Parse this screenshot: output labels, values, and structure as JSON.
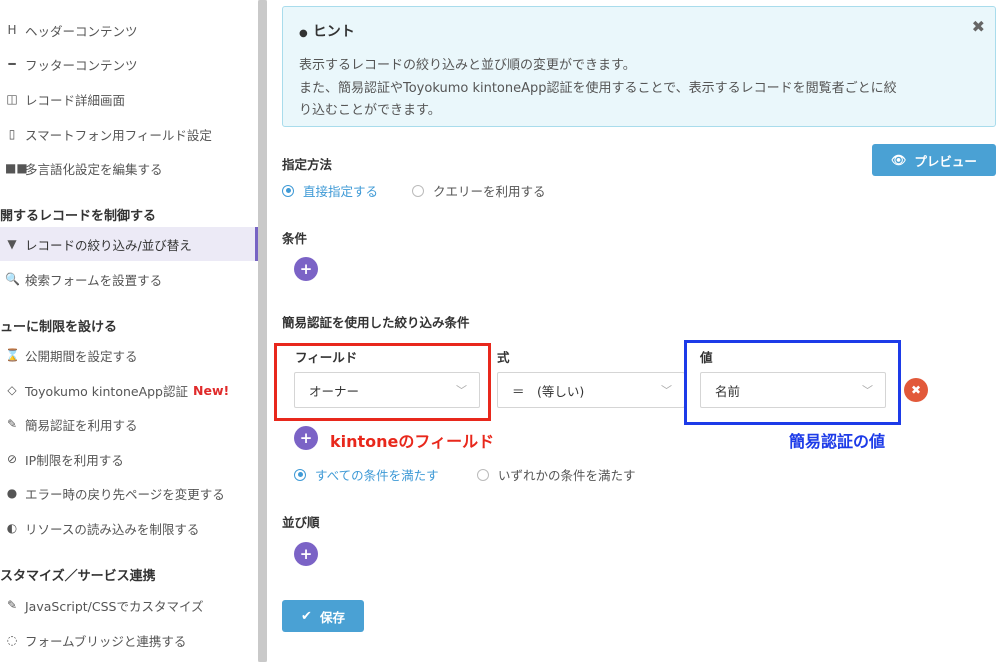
{
  "sidebar": {
    "items_top": [
      {
        "icon": "H",
        "label": "ヘッダーコンテンツ"
      },
      {
        "icon": "━",
        "label": "フッターコンテンツ"
      },
      {
        "icon": "◫",
        "label": "レコード詳細画面"
      },
      {
        "icon": "▯",
        "label": "スマートフォン用フィールド設定"
      },
      {
        "icon": "■■",
        "label": "多言語化設定を編集する"
      }
    ],
    "section1": "開するレコードを制御する",
    "items_record": [
      {
        "icon": "▼",
        "label": "レコードの絞り込み/並び替え"
      },
      {
        "icon": "🔍",
        "label": "検索フォームを設置する"
      }
    ],
    "section2": "ューに制限を設ける",
    "items_limit": [
      {
        "icon": "⌛",
        "label": "公開期間を設定する"
      },
      {
        "icon": "◇",
        "label": "Toyokumo kintoneApp認証",
        "badge": "New!"
      },
      {
        "icon": "✎",
        "label": "簡易認証を利用する"
      },
      {
        "icon": "⊘",
        "label": "IP制限を利用する"
      },
      {
        "icon": "●",
        "label": "エラー時の戻り先ページを変更する"
      },
      {
        "icon": "◐",
        "label": "リソースの読み込みを制限する"
      }
    ],
    "section3": "スタマイズ／サービス連携",
    "items_custom": [
      {
        "icon": "✎",
        "label": "JavaScript/CSSでカスタマイズ"
      },
      {
        "icon": "◌",
        "label": "フォームブリッジと連携する"
      }
    ]
  },
  "hint": {
    "icon": "●",
    "title": "ヒント",
    "line1": "表示するレコードの絞り込みと並び順の変更ができます。",
    "line2": "また、簡易認証やToyokumo kintoneApp認証を使用することで、表示するレコードを閲覧者ごとに絞",
    "line3": "り込むことができます。",
    "close": "✖"
  },
  "spec": {
    "label": "指定方法",
    "option_direct": "直接指定する",
    "option_query": "クエリーを利用する"
  },
  "preview_button": {
    "icon": "👁",
    "label": "プレビュー"
  },
  "conditions": {
    "label": "条件"
  },
  "auth_filter": {
    "label": "簡易認証を使用した絞り込み条件",
    "field_label": "フィールド",
    "expr_label": "式",
    "value_label": "値",
    "field_value": "オーナー",
    "expr_value": "＝　(等しい)",
    "value_value": "名前",
    "remove_icon": "✖",
    "annot_field": "kintoneのフィールド",
    "annot_value": "簡易認証の値",
    "match_all": "すべての条件を満たす",
    "match_any": "いずれかの条件を満たす"
  },
  "sort": {
    "label": "並び順"
  },
  "save_button": {
    "icon": "✔",
    "label": "保存"
  },
  "colors": {
    "accent": "#4aa1d4",
    "purple": "#7b63c6",
    "red_annot": "#e8281c",
    "blue_annot": "#1d3be8"
  }
}
